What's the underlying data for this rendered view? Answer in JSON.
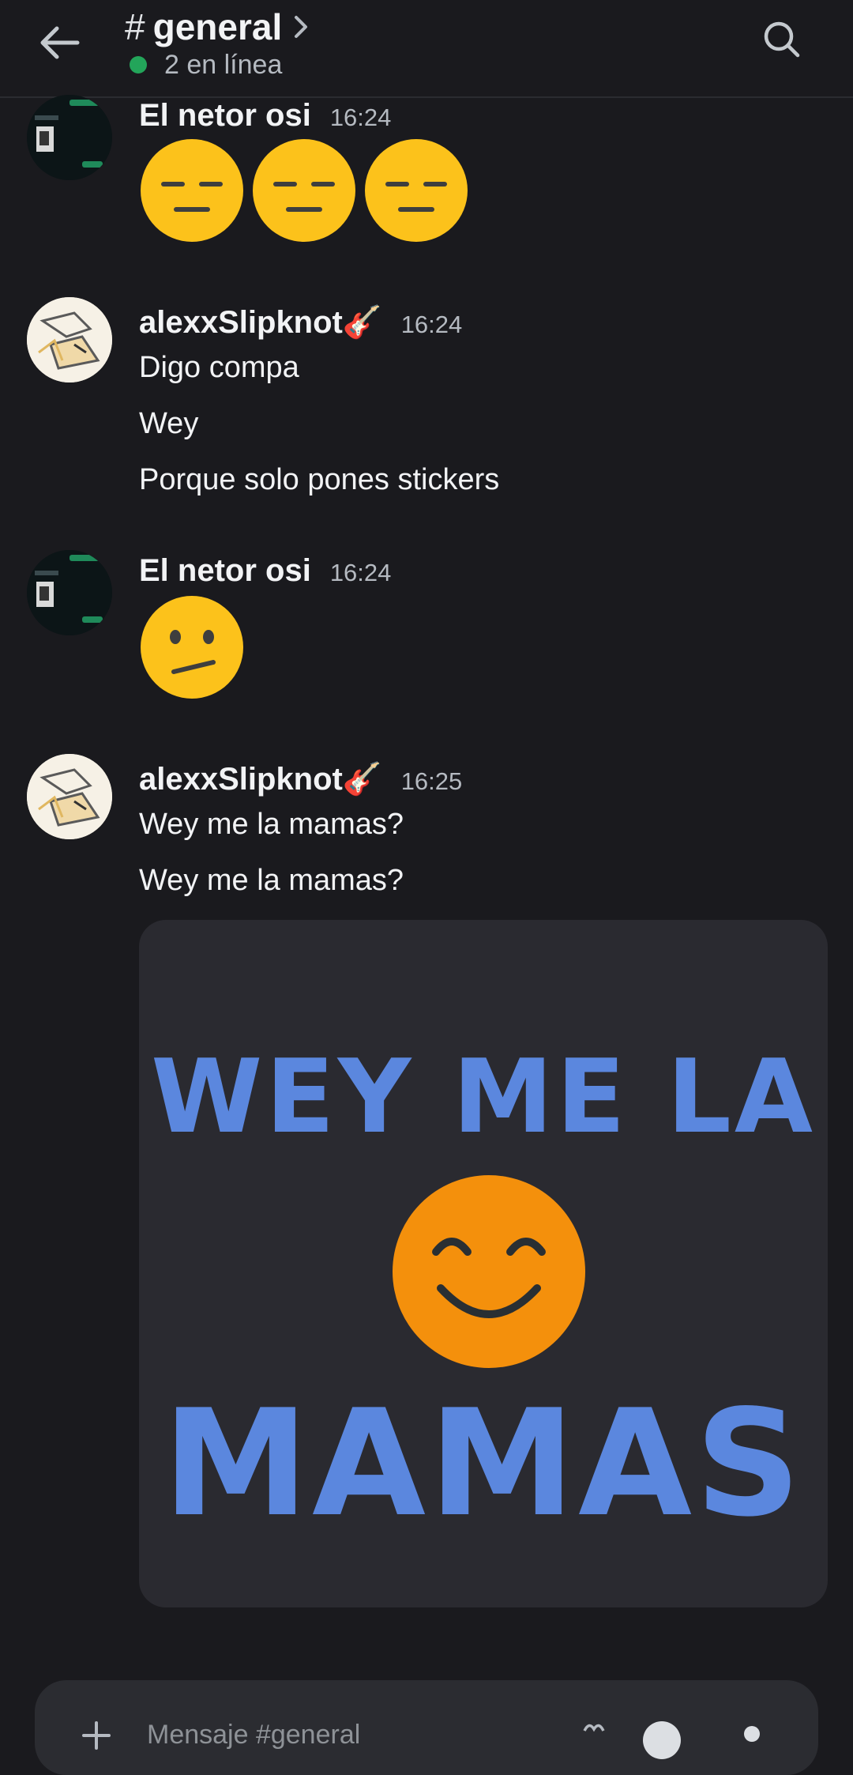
{
  "header": {
    "hash": "#",
    "channel_name": "general",
    "online_status": "2 en línea"
  },
  "messages": [
    {
      "username": "El netor osi",
      "time": "16:24",
      "stickers": [
        "expressionless-emoji",
        "expressionless-emoji",
        "expressionless-emoji"
      ]
    },
    {
      "username": "alexxSlipknot🎸",
      "time": "16:24",
      "lines": [
        "Digo compa",
        "Wey",
        "Porque solo pones stickers"
      ]
    },
    {
      "username": "El netor osi",
      "time": "16:24",
      "stickers": [
        "confused-emoji"
      ]
    },
    {
      "username": "alexxSlipknot🎸",
      "time": "16:25",
      "lines": [
        "Wey me la mamas?",
        "Wey me la mamas?"
      ]
    }
  ],
  "sticker_image": {
    "top_text": "WEY ME LA",
    "bottom_text": "MAMAS"
  },
  "composer": {
    "placeholder": "Mensaje #general"
  },
  "colors": {
    "background": "#1a1a1e",
    "online": "#23a55a",
    "emoji_yellow": "#fcc21b",
    "sticker_blue": "#5b87de",
    "sticker_orange": "#f4900c"
  }
}
